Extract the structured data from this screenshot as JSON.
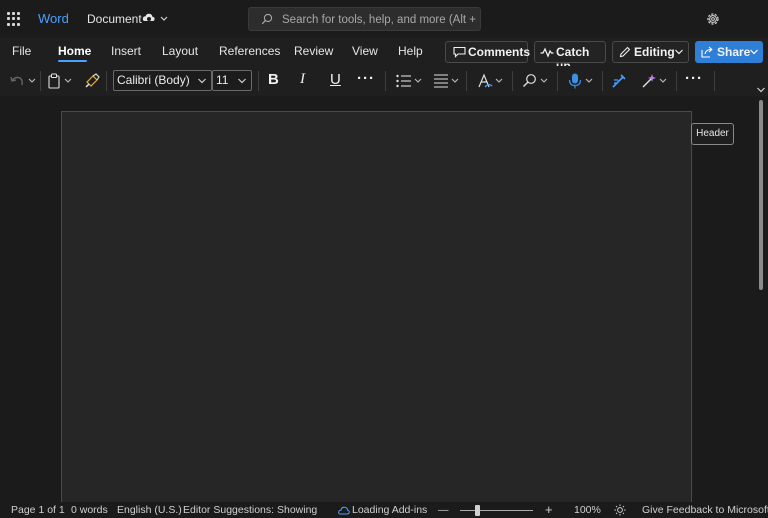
{
  "titlebar": {
    "app_name": "Word",
    "document_name": "Document",
    "search_placeholder": "Search for tools, help, and more (Alt + Q)"
  },
  "ribbon": {
    "tabs": [
      {
        "label": "File"
      },
      {
        "label": "Home",
        "active": true
      },
      {
        "label": "Insert"
      },
      {
        "label": "Layout"
      },
      {
        "label": "References"
      },
      {
        "label": "Review"
      },
      {
        "label": "View"
      },
      {
        "label": "Help"
      }
    ],
    "comments_label": "Comments",
    "catchup_label": "Catch up",
    "editing_label": "Editing",
    "share_label": "Share"
  },
  "toolbar": {
    "font_name": "Calibri (Body)",
    "font_size": "11",
    "bold": "B",
    "italic": "I",
    "underline": "U",
    "more": "···",
    "more_end": "···"
  },
  "document": {
    "header_tag": "Header"
  },
  "statusbar": {
    "page": "Page 1 of 1",
    "words": "0 words",
    "language": "English (U.S.)",
    "editor": "Editor Suggestions: Showing",
    "addins": "Loading Add-ins",
    "zoom_minus": "—",
    "zoom_plus": "+",
    "zoom": "100%",
    "feedback": "Give Feedback to Microsoft"
  },
  "colors": {
    "accent": "#4aa0ff",
    "share_button": "#2f7fd6",
    "background": "#1f1f1f",
    "page": "#262626"
  },
  "icons": [
    "app-launcher-icon",
    "cloud-sync-icon",
    "search-icon",
    "settings-icon",
    "undo-icon",
    "paste-icon",
    "format-painter-icon",
    "bullets-icon",
    "align-icon",
    "styles-icon",
    "find-icon",
    "dictate-icon",
    "editor-icon",
    "designer-icon",
    "comment-icon",
    "pulse-icon",
    "pencil-icon",
    "share-icon",
    "sun-icon"
  ]
}
